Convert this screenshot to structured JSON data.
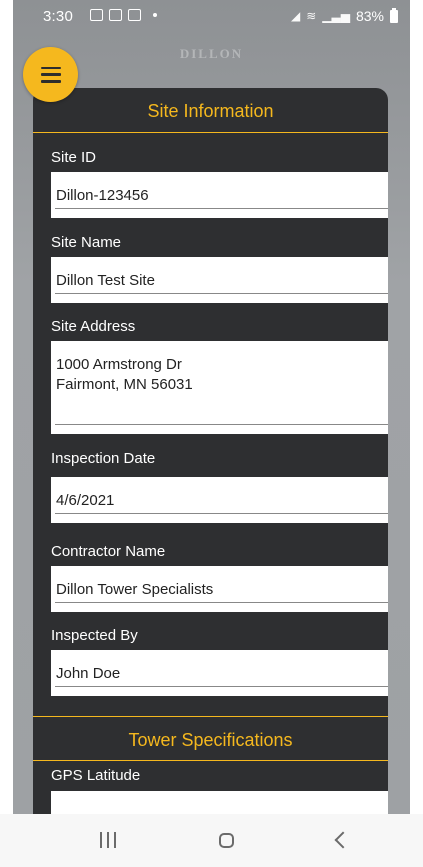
{
  "status_bar": {
    "time": "3:30",
    "battery": "83%"
  },
  "brand": {
    "logo_text": "DILLON"
  },
  "sections": {
    "site_information": "Site Information",
    "tower_specifications": "Tower Specifications"
  },
  "fields": {
    "site_id": {
      "label": "Site ID",
      "value": "Dillon-123456"
    },
    "site_name": {
      "label": "Site Name",
      "value": "Dillon Test Site"
    },
    "site_address": {
      "label": "Site Address",
      "value": "1000 Armstrong Dr\nFairmont, MN 56031"
    },
    "inspection_date": {
      "label": "Inspection Date",
      "value": "4/6/2021"
    },
    "contractor_name": {
      "label": "Contractor Name",
      "value": "Dillon Tower Specialists"
    },
    "inspected_by": {
      "label": "Inspected By",
      "value": "John Doe"
    },
    "gps_latitude": {
      "label": "GPS Latitude",
      "value": ""
    }
  },
  "colors": {
    "accent": "#f5b81e",
    "card_background": "#2e2f31",
    "app_background": "#9ea1a4"
  },
  "icons": {
    "menu": "hamburger-menu-icon",
    "nav_recents": "recents-icon",
    "nav_home": "home-icon",
    "nav_back": "back-icon"
  }
}
